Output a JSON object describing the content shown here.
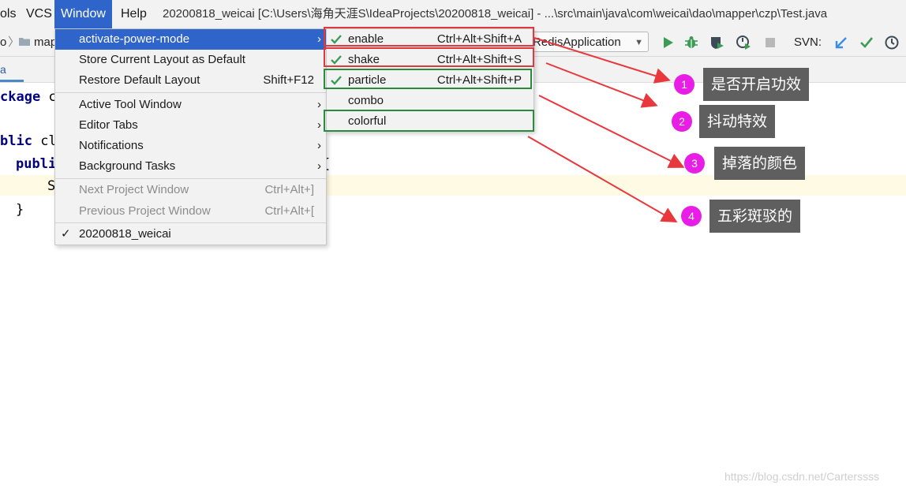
{
  "menubar": {
    "items": [
      "ols",
      "VCS",
      "Window",
      "Help"
    ],
    "window_title": "20200818_weicai [C:\\Users\\海角天涯S\\IdeaProjects\\20200818_weicai] - ...\\src\\main\\java\\com\\weicai\\dao\\mapper\\czp\\Test.java"
  },
  "navbar": {
    "crumb_partial": "o",
    "folder_label": "map",
    "run_config": "RedisApplication",
    "svn_label": "SVN:"
  },
  "tabs": {
    "partial_tab": "a"
  },
  "code": {
    "line1_kw": "ckage",
    "line1_rest": " c",
    "line2_kw": "blic",
    "line2_rest": " cl",
    "line3_kw": "publi",
    "line3_brace": "{",
    "line4_text": "S",
    "line5_text": "}"
  },
  "window_menu": {
    "items": [
      {
        "label": "activate-power-mode",
        "shortcut": "",
        "submenu": true
      },
      {
        "label": "Store Current Layout as Default",
        "shortcut": ""
      },
      {
        "label": "Restore Default Layout",
        "shortcut": "Shift+F12"
      },
      {
        "label": "Active Tool Window",
        "shortcut": "",
        "submenu": true
      },
      {
        "label": "Editor Tabs",
        "shortcut": "",
        "submenu": true
      },
      {
        "label": "Notifications",
        "shortcut": "",
        "submenu": true
      },
      {
        "label": "Background Tasks",
        "shortcut": "",
        "submenu": true
      },
      {
        "label": "Next Project Window",
        "shortcut": "Ctrl+Alt+]"
      },
      {
        "label": "Previous Project Window",
        "shortcut": "Ctrl+Alt+["
      },
      {
        "label": "20200818_weicai",
        "shortcut": "",
        "checked": true
      }
    ]
  },
  "submenu": {
    "items": [
      {
        "label": "enable",
        "shortcut": "Ctrl+Alt+Shift+A",
        "checked": true
      },
      {
        "label": "shake",
        "shortcut": "Ctrl+Alt+Shift+S",
        "checked": true
      },
      {
        "label": "particle",
        "shortcut": "Ctrl+Alt+Shift+P",
        "checked": true
      },
      {
        "label": "combo",
        "shortcut": ""
      },
      {
        "label": "colorful",
        "shortcut": ""
      }
    ]
  },
  "annotations": [
    {
      "number": "1",
      "label": "是否开启功效"
    },
    {
      "number": "2",
      "label": "抖动特效"
    },
    {
      "number": "3",
      "label": "掉落的颜色"
    },
    {
      "number": "4",
      "label": "五彩斑驳的"
    }
  ],
  "watermark": "https://blog.csdn.net/Carterssss",
  "colors": {
    "menu_selected": "#2f65ca",
    "annotation_circle": "#e81ee6",
    "annotation_label_bg": "#5f5f5f",
    "arrow_red": "#e8383d",
    "box_red": "#e0383f",
    "box_green": "#2b8a3e",
    "check_green": "#3b9c5a"
  }
}
